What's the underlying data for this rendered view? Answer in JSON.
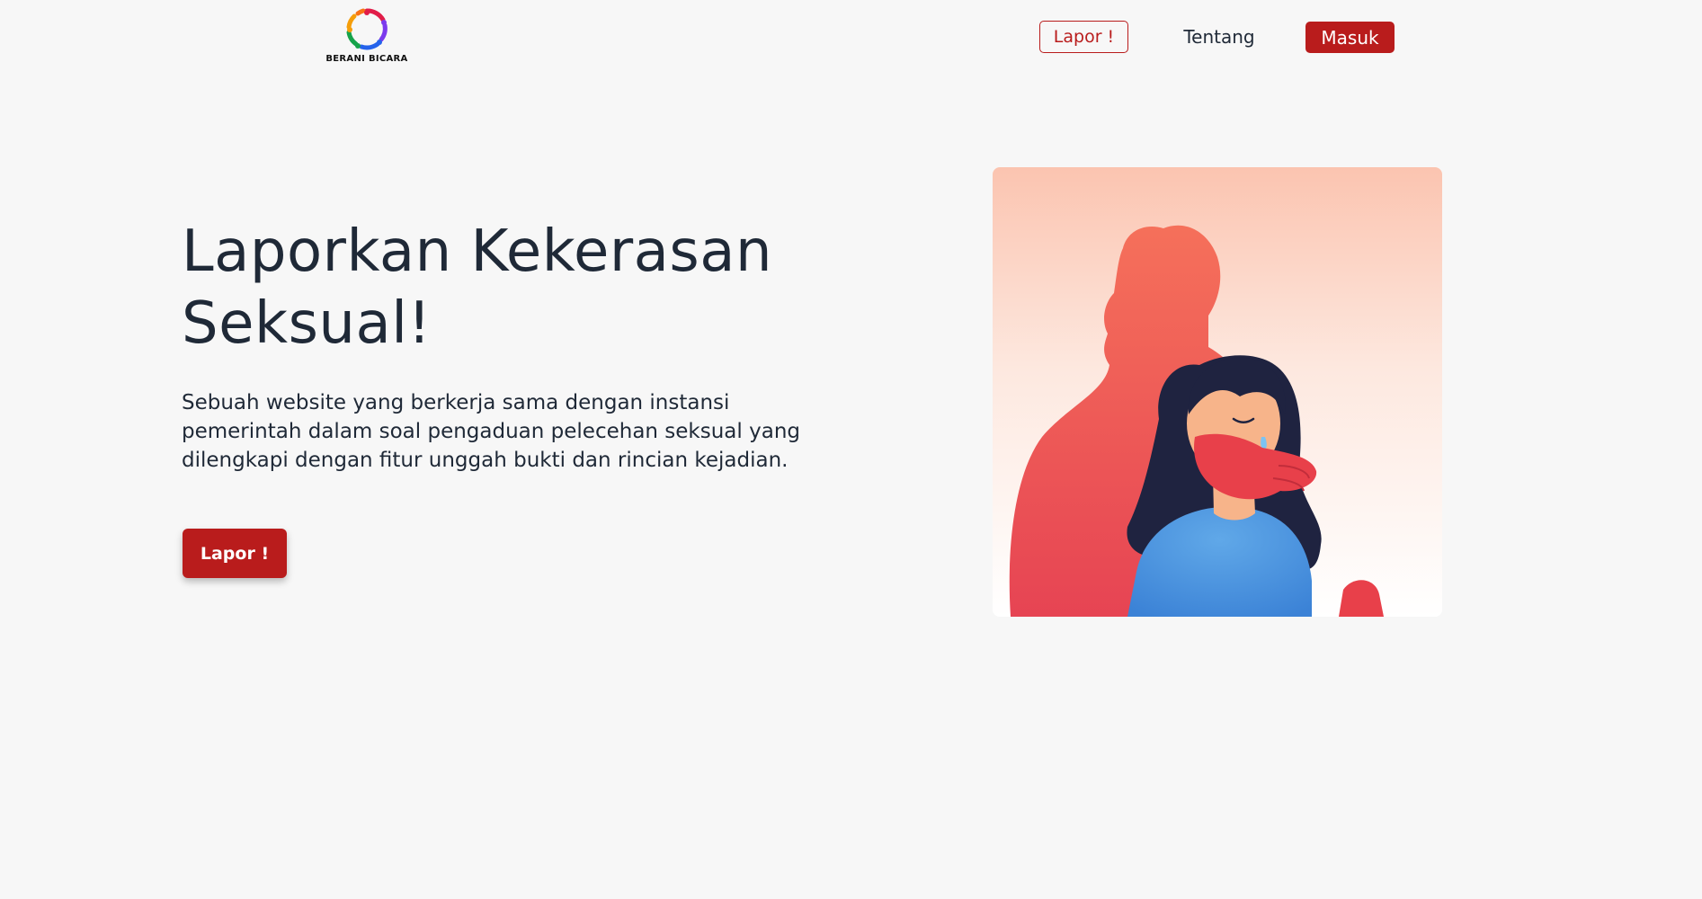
{
  "navbar": {
    "logo_text": "BERANI BICARA",
    "logo_icon": "berani-bicara-logo",
    "lapor_label": "Lapor !",
    "tentang_label": "Tentang",
    "masuk_label": "Masuk"
  },
  "hero": {
    "title": "Laporkan Kekerasan Seksual!",
    "description": "Sebuah website yang berkerja sama dengan instansi pemerintah dalam soal pengaduan pelecehan seksual yang dilengkapi dengan fitur unggah bukti dan rincian kejadian.",
    "button_label": "Lapor !",
    "illustration": "harassment-illustration"
  },
  "colors": {
    "accent": "#b91c1c",
    "background": "#f7f7f7",
    "text": "#1f2937"
  }
}
